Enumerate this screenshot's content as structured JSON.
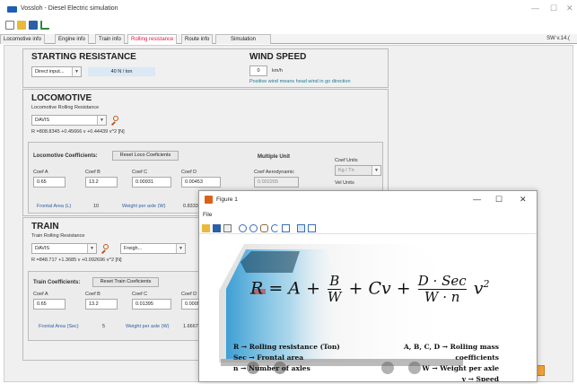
{
  "window": {
    "title": "Vossloh - Diesel Electric simulation",
    "controls": [
      "—",
      "☐",
      "✕"
    ]
  },
  "tabs": [
    {
      "label": "Locomotive info",
      "active": false
    },
    {
      "label": "Engine info",
      "active": false
    },
    {
      "label": "Train info",
      "active": false
    },
    {
      "label": "Rolling resistance",
      "active": true
    },
    {
      "label": "Route info",
      "active": false
    },
    {
      "label": "Simulation",
      "active": false
    }
  ],
  "version": "SW v.14.(",
  "starting_resistance": {
    "title": "STARTING RESISTANCE",
    "mode": "Direct input...",
    "value": "40 N / ton"
  },
  "wind_speed": {
    "title": "WIND SPEED",
    "value": "0",
    "unit": "km/h",
    "note": "Positive wind means head wind in go direction"
  },
  "locomotive": {
    "title": "LOCOMOTIVE",
    "subtitle": "Locomotive Rolling Resistance",
    "method": "DAVIS",
    "formula": "R =808.8345 +0.45666 v +0.44439 v^2  [N]",
    "coef_label": "Locomotive Coefficients:",
    "reset_label": "Reset Loco Coeficients",
    "coefs": [
      {
        "label": "Coef A",
        "value": "0.65"
      },
      {
        "label": "Coef B",
        "value": "13.2"
      },
      {
        "label": "Coef C",
        "value": "0.00931"
      },
      {
        "label": "Coef D",
        "value": "0.00453"
      }
    ],
    "multiple_unit": "Multiple Unit",
    "coef_aero_label": "Coef Aerodynamic",
    "coef_aero_value": "0.002265",
    "coef_units_label": "Coef Units",
    "coef_units_value": "Kg / Tn",
    "vel_units_label": "Vel Units",
    "frontal_area_label": "Frontal Area (L)",
    "frontal_area_value": "10",
    "weight_axle_label": "Weight per axle (W)",
    "weight_axle_value": "0.83333"
  },
  "train": {
    "title": "TRAIN",
    "subtitle": "Train Rolling Resistance",
    "method": "DAVIS",
    "type": "Freigh...",
    "formula": "R =848.717 +1.3685 v +0.092696 v^2  [N]",
    "coef_label": "Train Coefficients:",
    "reset_label": "Reset Train Coeficients",
    "coefs": [
      {
        "label": "Coef A",
        "value": "0.65"
      },
      {
        "label": "Coef B",
        "value": "13.2"
      },
      {
        "label": "Coef C",
        "value": "0.01395"
      },
      {
        "label": "Coef D",
        "value": "0.0009"
      }
    ],
    "frontal_area_label": "Frontal Area (Sec)",
    "frontal_area_value": "5",
    "weight_axle_label": "Weight per axle (W)",
    "weight_axle_value": "1.6667"
  },
  "figure": {
    "title": "Figure 1",
    "menu": "File",
    "formula": {
      "lhs": "R = A +",
      "b_num": "B",
      "b_den": "W",
      "mid": "+ Cv +",
      "d_num": "D · Sec",
      "d_den": "W · n",
      "tail": "v",
      "exp": "2"
    },
    "legend": [
      "R → Rolling resistance (Ton)",
      "Sec → Frontal area",
      "n → Number of axles",
      "A, B, C, D → Rolling mass coefficients",
      "W → Weight per axle",
      "v → Speed"
    ]
  },
  "colors": {
    "accent": "#e1173f",
    "info_bg": "#dbe8f6",
    "link": "#1e7a8f",
    "loco_blue": "#2aa8e0"
  }
}
